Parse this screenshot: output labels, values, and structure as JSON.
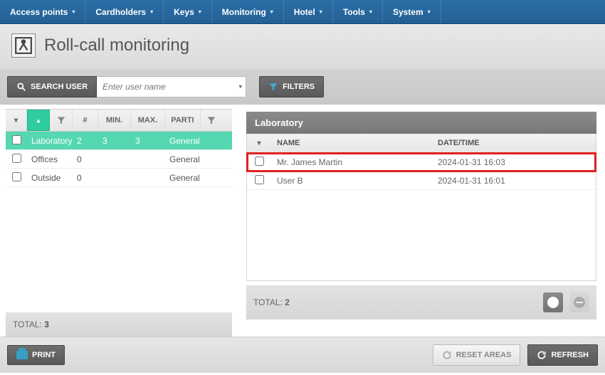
{
  "nav": {
    "items": [
      {
        "label": "Access points"
      },
      {
        "label": "Cardholders"
      },
      {
        "label": "Keys"
      },
      {
        "label": "Monitoring"
      },
      {
        "label": "Hotel"
      },
      {
        "label": "Tools"
      },
      {
        "label": "System"
      }
    ]
  },
  "page": {
    "title": "Roll-call monitoring"
  },
  "toolbar": {
    "search_button": "SEARCH USER",
    "search_placeholder": "Enter user name",
    "filters_button": "FILTERS"
  },
  "areas_grid": {
    "headers": {
      "count": "#",
      "min": "MIN.",
      "max": "MAX.",
      "partition": "PARTI"
    },
    "rows": [
      {
        "name": "Laboratory",
        "count": "2",
        "min": "3",
        "max": "3",
        "partition": "General",
        "selected": true
      },
      {
        "name": "Offices",
        "count": "0",
        "min": "",
        "max": "",
        "partition": "General",
        "selected": false
      },
      {
        "name": "Outside",
        "count": "0",
        "min": "",
        "max": "",
        "partition": "General",
        "selected": false
      }
    ],
    "total_label": "TOTAL:",
    "total_value": "3"
  },
  "detail": {
    "title": "Laboratory",
    "headers": {
      "name": "NAME",
      "datetime": "DATE/TIME"
    },
    "rows": [
      {
        "name": "Mr. James Martin",
        "datetime": "2024-01-31 16:03",
        "highlight": true
      },
      {
        "name": "User B",
        "datetime": "2024-01-31 16:01",
        "highlight": false
      }
    ],
    "total_label": "TOTAL:",
    "total_value": "2"
  },
  "footer": {
    "print": "PRINT",
    "reset": "RESET AREAS",
    "refresh": "REFRESH"
  }
}
